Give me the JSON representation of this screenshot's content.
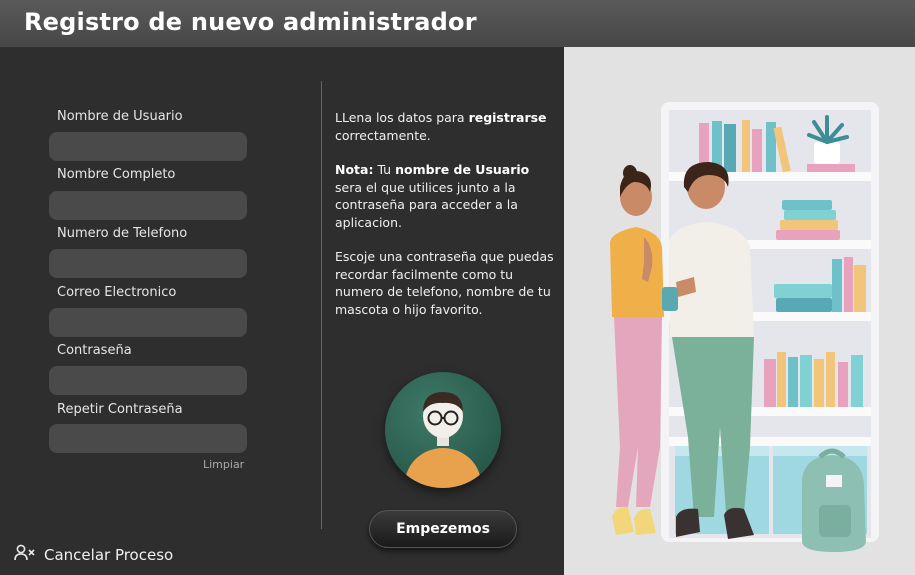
{
  "window": {
    "title": "Registro de nuevo administrador"
  },
  "form": {
    "fields": [
      {
        "label": "Nombre de Usuario",
        "value": "",
        "placeholder": ""
      },
      {
        "label": "Nombre Completo",
        "value": "",
        "placeholder": ""
      },
      {
        "label": "Numero de Telefono",
        "value": "",
        "placeholder": ""
      },
      {
        "label": "Correo Electronico",
        "value": "",
        "placeholder": ""
      },
      {
        "label": "Contraseña",
        "value": "",
        "placeholder": ""
      },
      {
        "label": "Repetir Contraseña",
        "value": "",
        "placeholder": ""
      }
    ],
    "clear_label": "Limpiar"
  },
  "info": {
    "p1_text": "LLena los datos para ",
    "p1_bold": "registrarse",
    "p1_end": " correctamente.",
    "p2_bold1": "Nota:",
    "p2_text1": " Tu ",
    "p2_bold2": "nombre de Usuario",
    "p2_text2": " sera el que utilices junto a la contraseña para acceder a la aplicacion.",
    "p3": "Escoje una contraseña que puedas recordar facilmente como tu numero de telefono, nombre de tu mascota o hijo favorito."
  },
  "actions": {
    "start_label": "Empezemos",
    "cancel_label": "Cancelar Proceso"
  },
  "icons": {
    "cancel": "user-x-icon",
    "avatar": "avatar-glasses-icon",
    "illustration": "bookshelf-couple-illustration"
  },
  "colors": {
    "background": "#2e2e2e",
    "titlebar": "#4f4f4f",
    "input": "#4a4a4a",
    "avatar": "#2f6a58",
    "illustration_bg": "#e2e2e2"
  }
}
